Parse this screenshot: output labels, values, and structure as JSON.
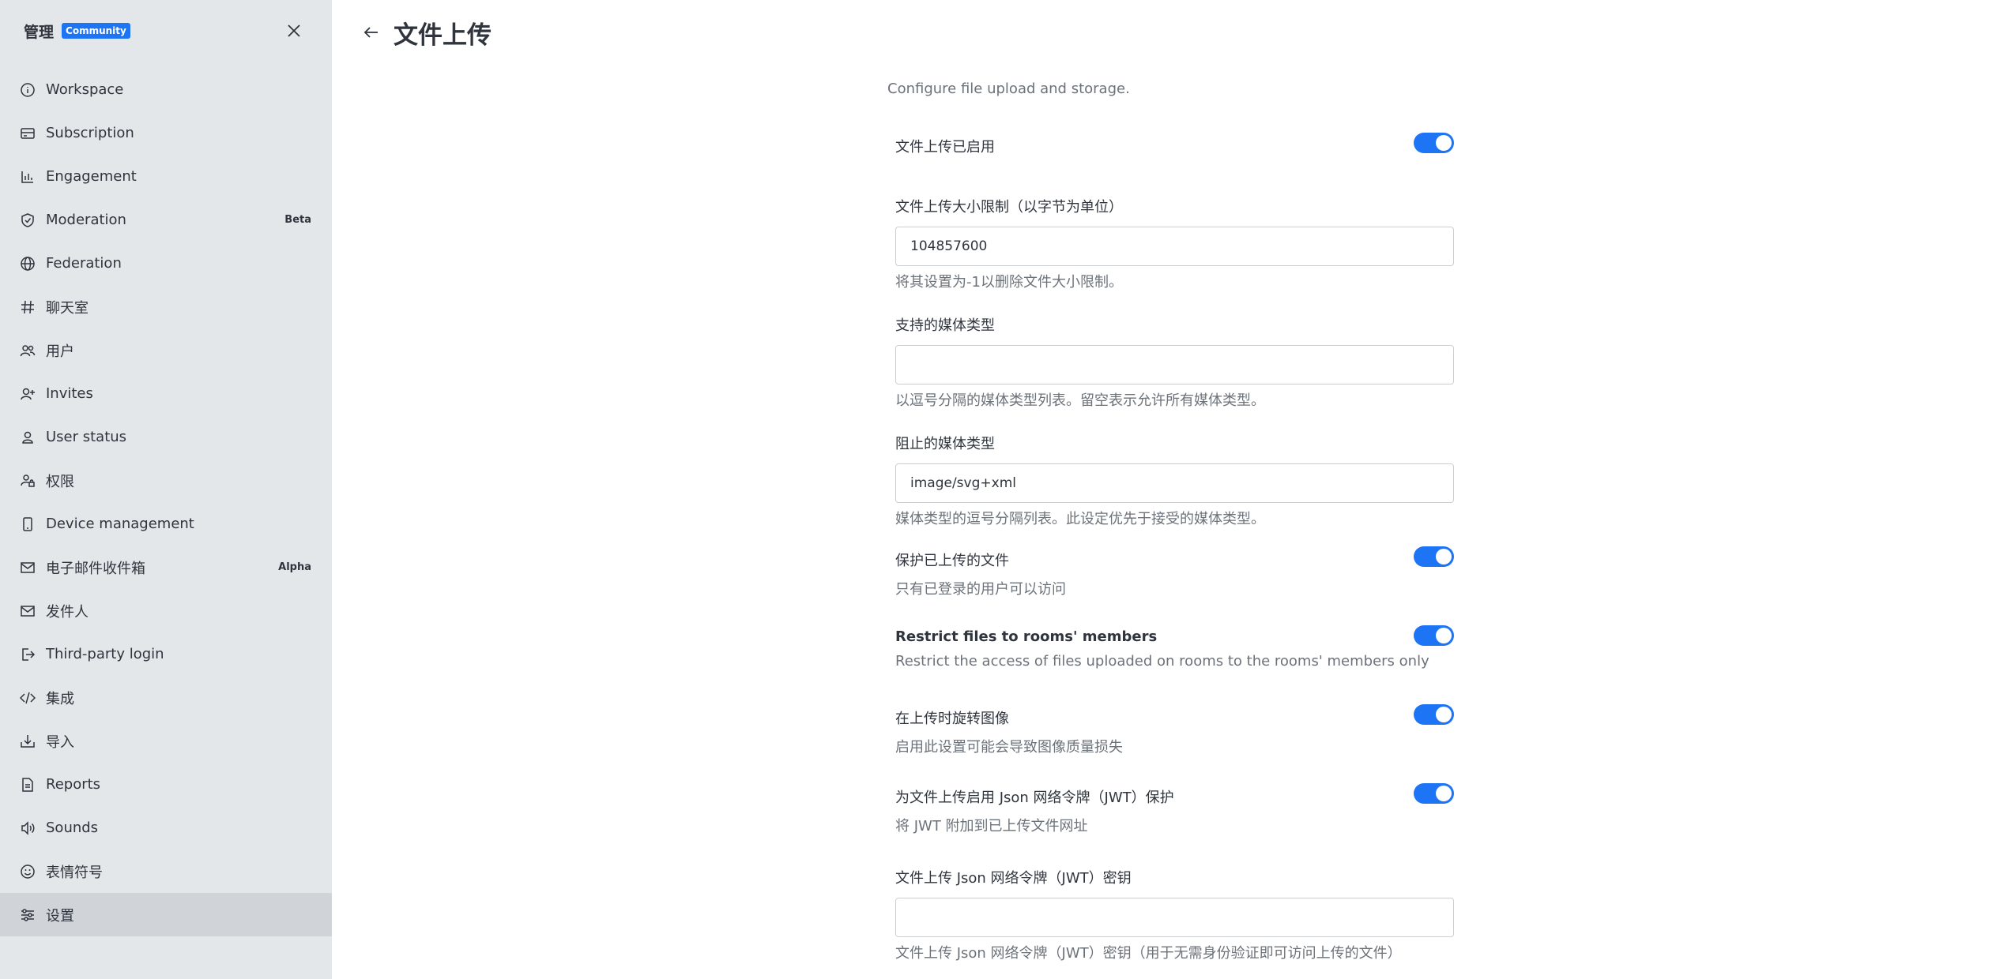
{
  "sidebar": {
    "title": "管理",
    "badge": "Community",
    "items": [
      {
        "label": "Workspace",
        "icon": "info-circle-icon",
        "tag": ""
      },
      {
        "label": "Subscription",
        "icon": "card-icon",
        "tag": ""
      },
      {
        "label": "Engagement",
        "icon": "bar-chart-icon",
        "tag": ""
      },
      {
        "label": "Moderation",
        "icon": "shield-icon",
        "tag": "Beta"
      },
      {
        "label": "Federation",
        "icon": "globe-icon",
        "tag": ""
      },
      {
        "label": "聊天室",
        "icon": "hashtag-icon",
        "tag": ""
      },
      {
        "label": "用户",
        "icon": "team-icon",
        "tag": ""
      },
      {
        "label": "Invites",
        "icon": "user-plus-icon",
        "tag": ""
      },
      {
        "label": "User status",
        "icon": "user-icon",
        "tag": ""
      },
      {
        "label": "权限",
        "icon": "user-lock-icon",
        "tag": ""
      },
      {
        "label": "Device management",
        "icon": "mobile-icon",
        "tag": ""
      },
      {
        "label": "电子邮件收件箱",
        "icon": "mail-icon",
        "tag": "Alpha"
      },
      {
        "label": "发件人",
        "icon": "mail-icon",
        "tag": ""
      },
      {
        "label": "Third-party login",
        "icon": "login-icon",
        "tag": ""
      },
      {
        "label": "集成",
        "icon": "code-icon",
        "tag": ""
      },
      {
        "label": "导入",
        "icon": "import-icon",
        "tag": ""
      },
      {
        "label": "Reports",
        "icon": "document-icon",
        "tag": ""
      },
      {
        "label": "Sounds",
        "icon": "sound-icon",
        "tag": ""
      },
      {
        "label": "表情符号",
        "icon": "emoji-icon",
        "tag": ""
      },
      {
        "label": "设置",
        "icon": "sliders-icon",
        "tag": "",
        "active": true
      }
    ]
  },
  "header": {
    "title": "文件上传"
  },
  "settings": {
    "description": "Configure file upload and storage.",
    "file_upload_enabled": {
      "label": "文件上传已启用",
      "value": true
    },
    "max_size": {
      "label": "文件上传大小限制（以字节为单位）",
      "value": "104857600",
      "hint": "将其设置为-1以删除文件大小限制。"
    },
    "accepted_types": {
      "label": "支持的媒体类型",
      "value": "",
      "hint": "以逗号分隔的媒体类型列表。留空表示允许所有媒体类型。"
    },
    "blocked_types": {
      "label": "阻止的媒体类型",
      "value": "image/svg+xml",
      "hint": "媒体类型的逗号分隔列表。此设定优先于接受的媒体类型。"
    },
    "protect_files": {
      "label": "保护已上传的文件",
      "hint": "只有已登录的用户可以访问",
      "value": true
    },
    "restrict_rooms": {
      "label": "Restrict files to rooms' members",
      "hint": "Restrict the access of files uploaded on rooms to the rooms' members only",
      "value": true
    },
    "rotate_images": {
      "label": "在上传时旋转图像",
      "hint": "启用此设置可能会导致图像质量损失",
      "value": true
    },
    "jwt_enable": {
      "label": "为文件上传启用 Json 网络令牌（JWT）保护",
      "hint": "将 JWT 附加到已上传文件网址",
      "value": true
    },
    "jwt_secret": {
      "label": "文件上传 Json 网络令牌（JWT）密钥",
      "value": "",
      "hint": "文件上传 Json 网络令牌（JWT）密钥（用于无需身份验证即可访问上传的文件）"
    }
  }
}
